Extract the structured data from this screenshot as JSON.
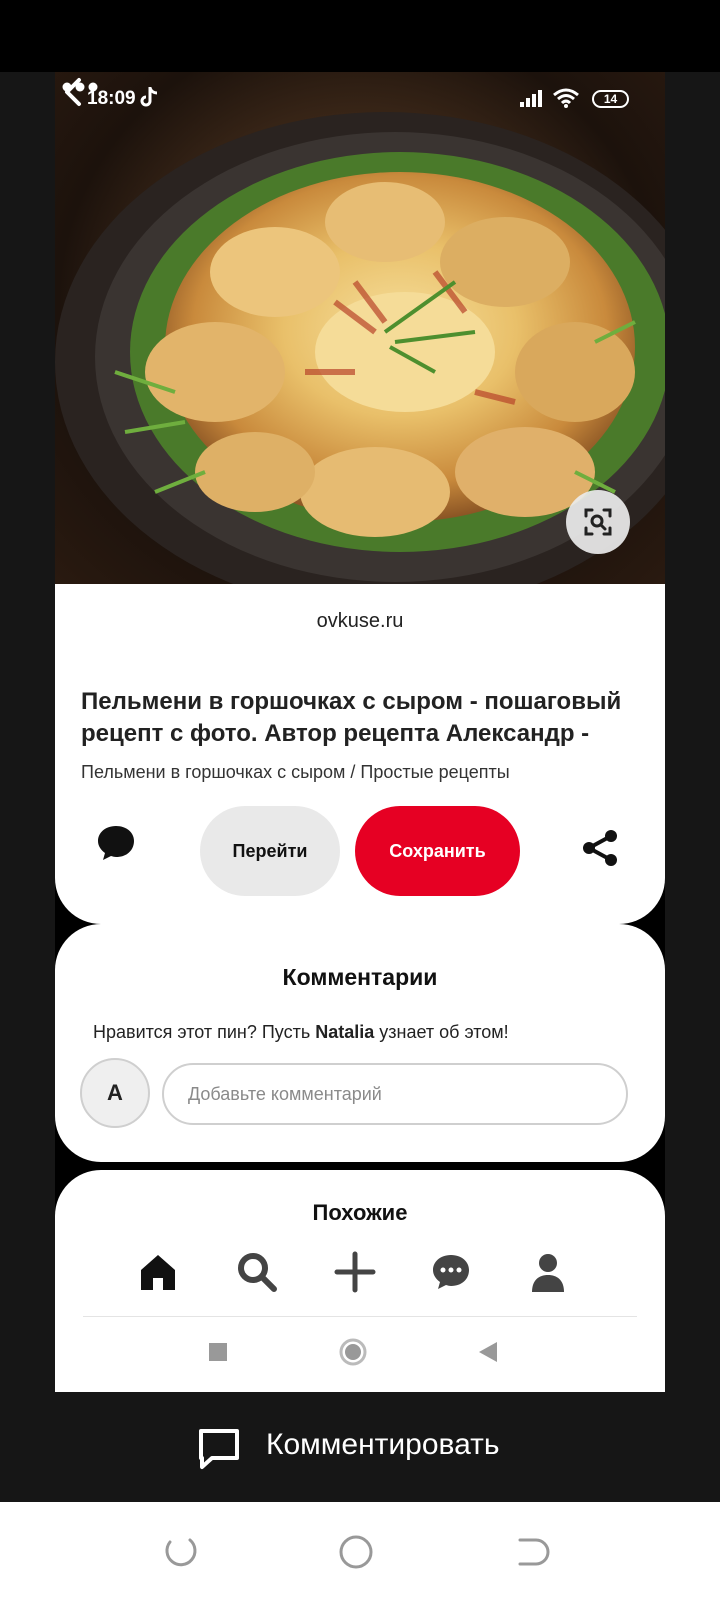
{
  "status_bar": {
    "time": "18:09",
    "battery": "14"
  },
  "pin": {
    "domain": "ovkuse.ru",
    "title": "Пельмени в горшочках с сыром - пошаговый рецепт с фото. Автор рецепта Александр -",
    "description": "Пельмени в горшочках с сыром / Простые рецепты",
    "visit_label": "Перейти",
    "save_label": "Сохранить"
  },
  "comments": {
    "title": "Комментарии",
    "hint_before": "Нравится этот пин? Пусть ",
    "hint_name": "Natalia",
    "hint_after": " узнает об этом!",
    "avatar_letter": "A",
    "input_placeholder": "Добавьте комментарий"
  },
  "similar": {
    "title": "Похожие"
  },
  "bottom_nav": {
    "items": [
      "home-icon",
      "search-icon",
      "plus-icon",
      "chat-icon",
      "profile-icon"
    ]
  },
  "comment_action": {
    "label": "Комментировать"
  },
  "colors": {
    "save_red": "#e60023",
    "visit_gray": "#e9e9e9"
  }
}
